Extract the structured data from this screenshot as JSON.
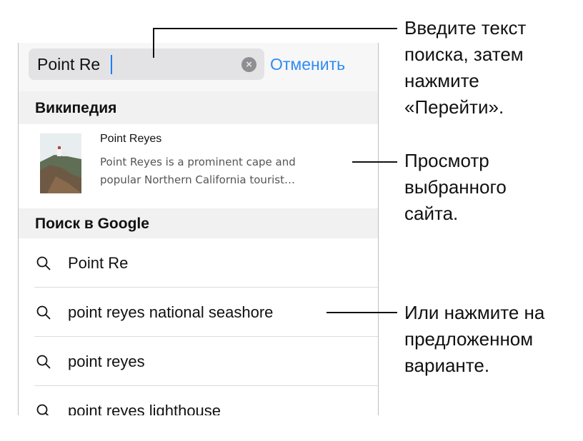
{
  "search": {
    "query": "Point Re",
    "cancel_label": "Отменить"
  },
  "wikipedia_section": {
    "title": "Википедия",
    "result": {
      "title": "Point Reyes",
      "desc_line1": "Point Reyes is a prominent cape and",
      "desc_line2": "popular Northern California tourist…"
    }
  },
  "google_section": {
    "title": "Поиск в Google",
    "suggestions": [
      "Point Re",
      "point reyes national seashore",
      "point reyes",
      "point reyes lighthouse"
    ]
  },
  "callouts": {
    "top": [
      "Введите текст",
      "поиска, затем",
      "нажмите",
      "«Перейти»."
    ],
    "middle": [
      "Просмотр",
      "выбранного",
      "сайта."
    ],
    "bottom": [
      "Или нажмите на",
      "предложенном",
      "варианте."
    ]
  },
  "colors": {
    "accent": "#2f8bf5",
    "caret": "#1b7cff"
  }
}
